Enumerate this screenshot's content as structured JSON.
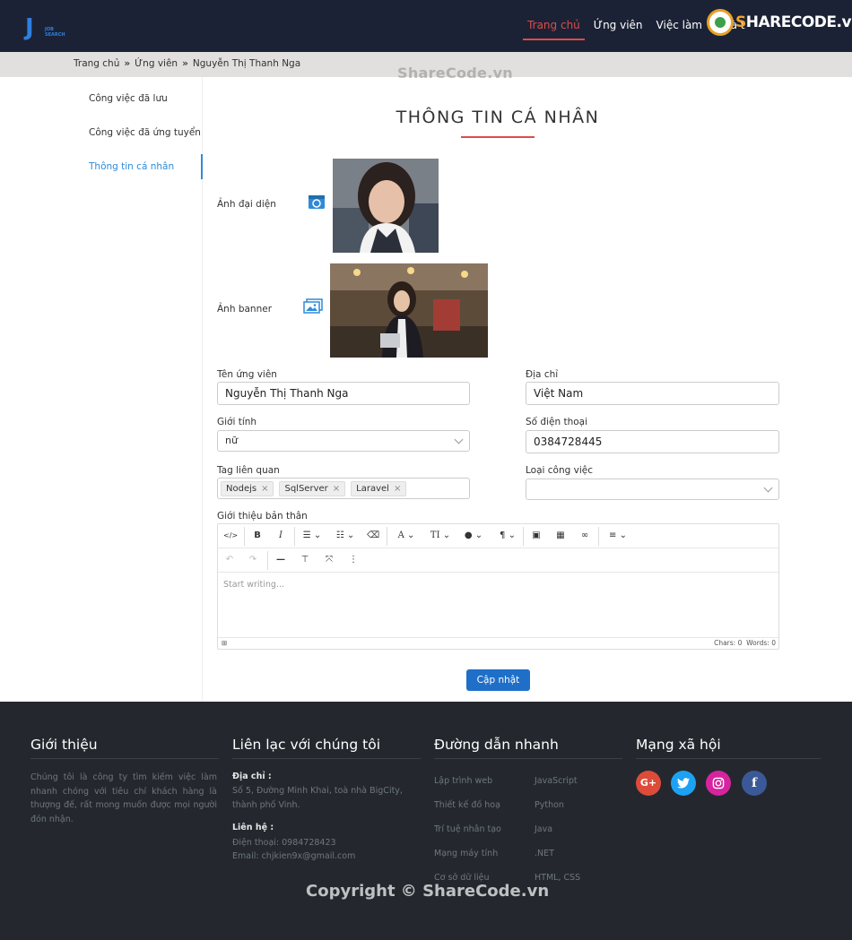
{
  "header": {
    "logo_letter": "J",
    "logo_sub": "JOB SEARCH",
    "nav": [
      "Trang chủ",
      "Ứng viên",
      "Việc làm",
      "Nhà t"
    ],
    "watermark_badge": "SHARECODE.vn"
  },
  "breadcrumb": [
    "Trang chủ",
    "Ứng viên",
    "Nguyễn Thị Thanh Nga"
  ],
  "watermark_top": "ShareCode.vn",
  "sidebar": [
    "Công việc đã lưu",
    "Công việc đã ứng tuyển",
    "Thông tin cá nhân"
  ],
  "page_title": "THÔNG TIN CÁ NHÂN",
  "form": {
    "avatar_label": "Ảnh đại diện",
    "banner_label": "Ảnh banner",
    "name_label": "Tên ứng viên",
    "name_value": "Nguyễn Thị Thanh Nga",
    "address_label": "Địa chỉ",
    "address_value": "Việt Nam",
    "gender_label": "Giới tính",
    "gender_value": "nữ",
    "phone_label": "Số điện thoại",
    "phone_value": "0384728445",
    "tags_label": "Tag liên quan",
    "tags": [
      "Nodejs",
      "SqlServer",
      "Laravel"
    ],
    "jobtype_label": "Loại công việc",
    "jobtype_value": "",
    "bio_label": "Giới thiệu bản thân",
    "editor_placeholder": "Start writing...",
    "chars": "Chars: 0",
    "words": "Words: 0",
    "submit": "Cập nhật"
  },
  "footer": {
    "about_heading": "Giới thiệu",
    "about_text": "Chúng tôi là công ty tìm kiếm việc làm nhanh chóng với tiêu chí khách hàng là thượng đế, rất mong muốn được mọi người đón nhận.",
    "contact_heading": "Liên lạc với chúng tôi",
    "address_title": "Địa chỉ :",
    "address_text": "Số 5, Đường Minh Khai, toà nhà BigCity, thành phố Vinh.",
    "contact_title": "Liên hệ :",
    "phone_text": "Điện thoại: 0984728423",
    "email_text": "Email: chjkien9x@gmail.com",
    "links_heading": "Đường dẫn nhanh",
    "links_col1": [
      "Lập trình web",
      "Thiết kế đồ hoạ",
      "Trí tuệ nhân tạo",
      "Mạng máy tính",
      "Cơ sở dữ liệu"
    ],
    "links_col2": [
      "JavaScript",
      "Python",
      "Java",
      ".NET",
      "HTML, CSS"
    ],
    "social_heading": "Mạng xã hội",
    "social": [
      "G+",
      "t",
      "ig",
      "f"
    ],
    "copyright": "Copyright © ShareCode.vn"
  },
  "colors": {
    "header_bg": "#1b2235",
    "accent_red": "#e04a4a",
    "accent_blue": "#2f8bd8",
    "button_blue": "#1f6fc8",
    "footer_bg": "#24282e"
  }
}
